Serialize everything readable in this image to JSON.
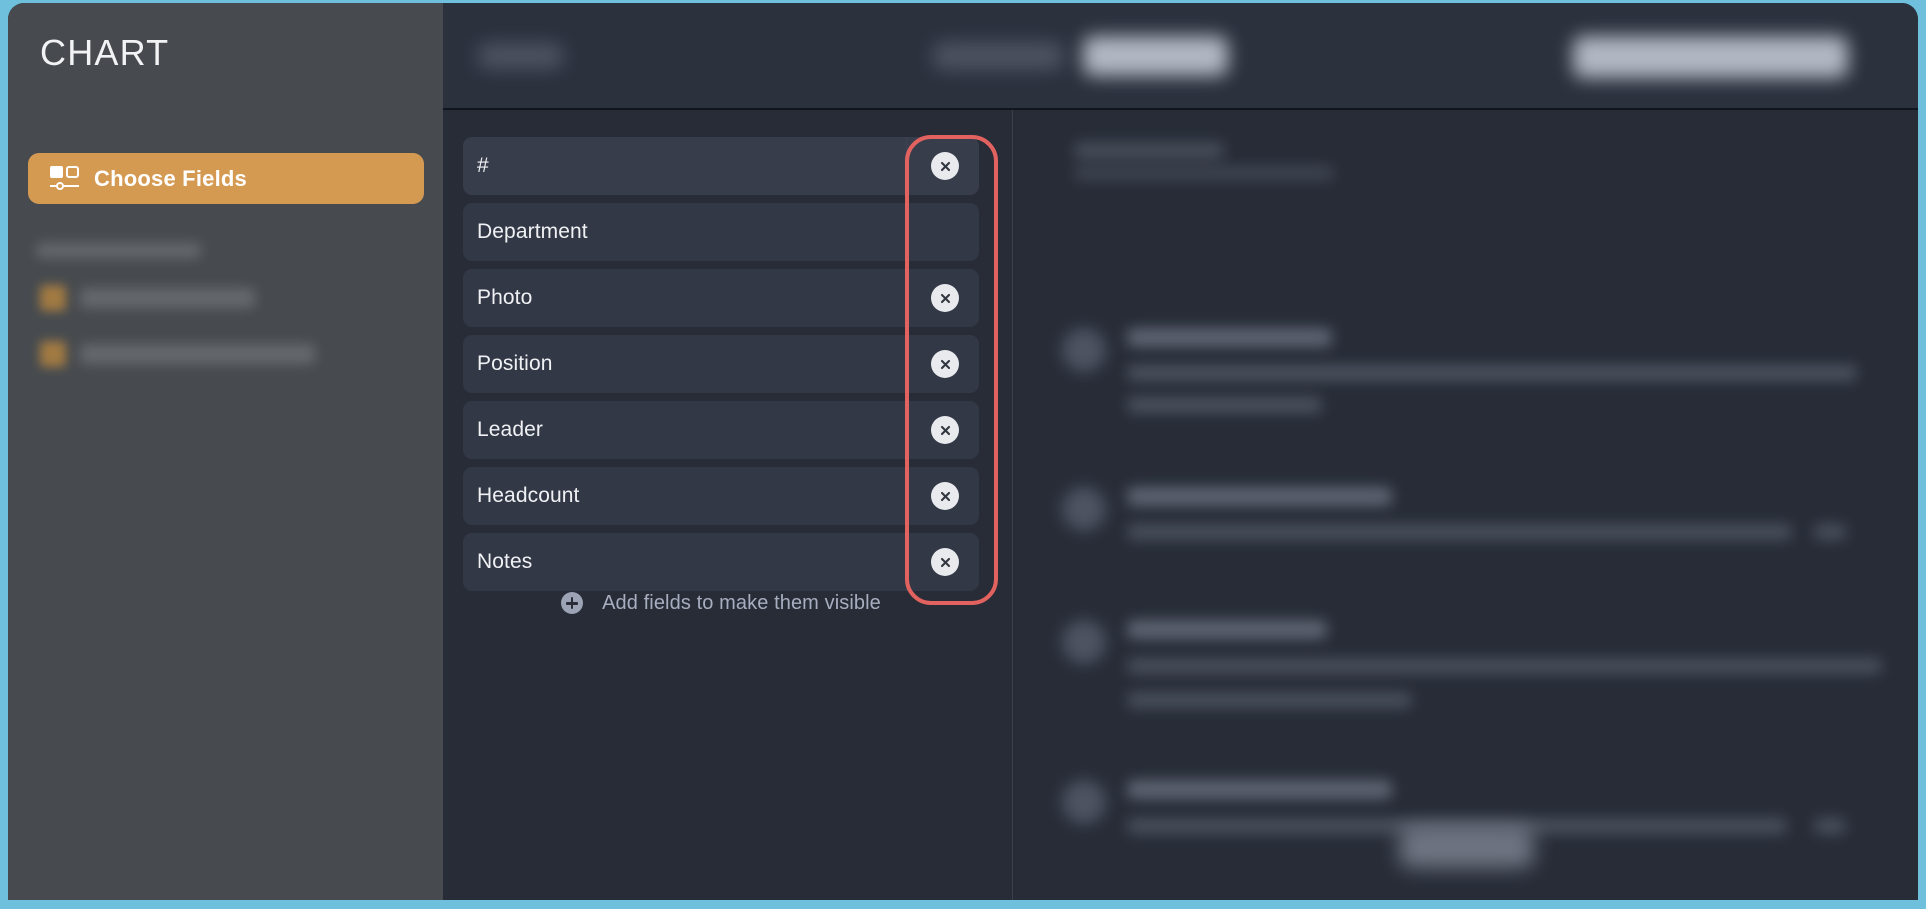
{
  "window": {
    "frame_color": "#6ec0dd",
    "background": "#262b36"
  },
  "sidebar": {
    "title": "CHART",
    "background": "#474b4f",
    "primary_button": {
      "label": "Choose Fields",
      "icon": "field-chooser-icon",
      "color": "#d59a52"
    },
    "blurred_section": {
      "section_label": "",
      "items": [
        {
          "label": "",
          "icon_color": "#c08a3e"
        },
        {
          "label": "",
          "icon_color": "#c08a3e"
        }
      ]
    }
  },
  "topbar": {
    "background": "#2b313d",
    "left_control": "",
    "center_tabs": [
      "",
      ""
    ],
    "right_control": ""
  },
  "fields_panel": {
    "background": "#272c37",
    "fields": [
      {
        "name": "#",
        "removable": true,
        "hovered": true
      },
      {
        "name": "Department",
        "removable": false,
        "hovered": false
      },
      {
        "name": "Photo",
        "removable": true,
        "hovered": false
      },
      {
        "name": "Position",
        "removable": true,
        "hovered": false
      },
      {
        "name": "Leader",
        "removable": true,
        "hovered": false
      },
      {
        "name": "Headcount",
        "removable": true,
        "hovered": false
      },
      {
        "name": "Notes",
        "removable": true,
        "hovered": false
      }
    ],
    "add_fields": {
      "label": "Add fields to make them visible",
      "icon": "plus-circle-icon"
    },
    "remove_icon": "close-circle-icon"
  },
  "annotation": {
    "type": "highlight-rectangle",
    "color": "#e2625f",
    "target": "remove-field-buttons-column"
  },
  "preview_panel": {
    "background": "#272c37",
    "rows": [
      {
        "avatar": true,
        "title": "",
        "body": ""
      },
      {
        "avatar": true,
        "title": "",
        "body": ""
      },
      {
        "avatar": true,
        "title": "",
        "body": ""
      },
      {
        "avatar": true,
        "title": "",
        "body": ""
      }
    ],
    "footer_button": ""
  }
}
